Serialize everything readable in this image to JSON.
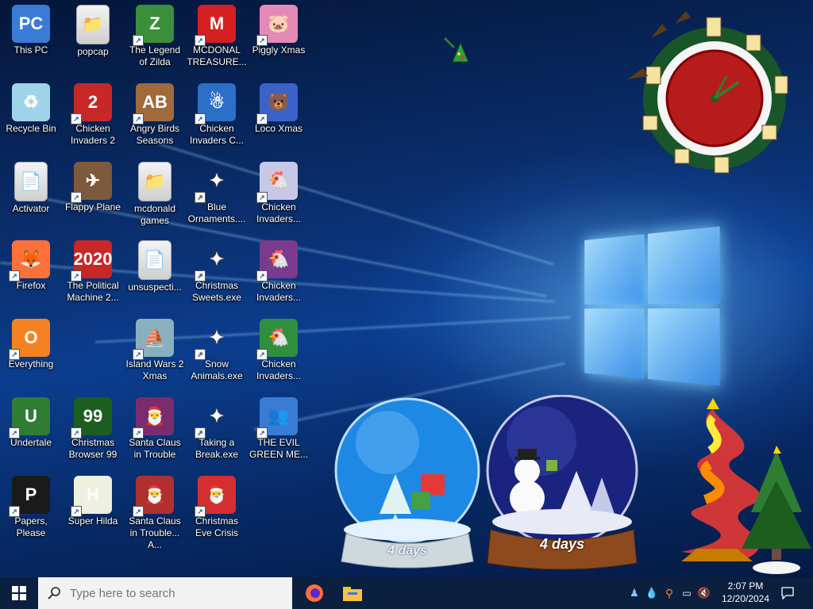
{
  "desktop": {
    "icons": [
      {
        "label": "This PC",
        "art": "PC",
        "color": "#3a7bd5"
      },
      {
        "label": "popcap",
        "art": "📁",
        "color": "#dddddd"
      },
      {
        "label": "The Legend of Zilda",
        "art": "Z",
        "color": "#3b8f3b"
      },
      {
        "label": "MCDONAL TREASURE...",
        "art": "M",
        "color": "#d42020"
      },
      {
        "label": "Piggly Xmas",
        "art": "🐷",
        "color": "#e58ab7"
      },
      {
        "label": "Recycle Bin",
        "art": "♻",
        "color": "#9fd4e8"
      },
      {
        "label": "Chicken Invaders 2",
        "art": "2",
        "color": "#c62828"
      },
      {
        "label": "Angry Birds Seasons",
        "art": "AB",
        "color": "#a06a3a"
      },
      {
        "label": "Chicken Invaders C...",
        "art": "☃",
        "color": "#2b6fc7"
      },
      {
        "label": "Loco Xmas",
        "art": "🐻",
        "color": "#3b62c8"
      },
      {
        "label": "Activator",
        "art": "📄",
        "color": "#dddddd"
      },
      {
        "label": "Flappy Plane",
        "art": "✈",
        "color": "#7d5a3c"
      },
      {
        "label": "mcdonald games",
        "art": "📁",
        "color": "#dddddd"
      },
      {
        "label": "Blue Ornaments....",
        "art": "✦",
        "color": "#f5a623"
      },
      {
        "label": "Chicken Invaders...",
        "art": "🐔",
        "color": "#c7c7e8"
      },
      {
        "label": "Firefox",
        "art": "🦊",
        "color": "#ff7139"
      },
      {
        "label": "The Political Machine 2...",
        "art": "2020",
        "color": "#c62828"
      },
      {
        "label": "unsuspecti...",
        "art": "📄",
        "color": "#dddddd"
      },
      {
        "label": "Christmas Sweets.exe",
        "art": "✦",
        "color": "#f5a623"
      },
      {
        "label": "Chicken Invaders...",
        "art": "🐔",
        "color": "#7a3b8f"
      },
      {
        "label": "Everything",
        "art": "O",
        "color": "#f58220"
      },
      {
        "label": "Island Wars 2 Xmas",
        "art": "⛵",
        "color": "#8ab0c0"
      },
      {
        "label": "Snow Animals.exe",
        "art": "✦",
        "color": "#f5a623"
      },
      {
        "label": "Chicken Invaders...",
        "art": "🐔",
        "color": "#2f8f3f"
      },
      {
        "label": "Undertale",
        "art": "U",
        "color": "#2e7d32"
      },
      {
        "label": "Christmas Browser 99",
        "art": "99",
        "color": "#1b5e20"
      },
      {
        "label": "Santa Claus in Trouble",
        "art": "🎅",
        "color": "#7b2c6f"
      },
      {
        "label": "Taking a Break.exe",
        "art": "✦",
        "color": "#f5a623"
      },
      {
        "label": "THE EVIL GREEN ME...",
        "art": "👥",
        "color": "#3a7bd5"
      },
      {
        "label": "Papers, Please",
        "art": "P",
        "color": "#1a1a1a"
      },
      {
        "label": "Super Hilda",
        "art": "H",
        "color": "#f0f0e0"
      },
      {
        "label": "Santa Claus in Trouble... A...",
        "art": "🎅",
        "color": "#b03030"
      },
      {
        "label": "Christmas Eve Crisis",
        "art": "🎅",
        "color": "#d32f2f"
      }
    ]
  },
  "widgets": {
    "globe_left": {
      "label": "4 days"
    },
    "globe_right": {
      "label": "4 days"
    }
  },
  "taskbar": {
    "search": {
      "placeholder": "Type here to search"
    },
    "clock": {
      "time": "2:07 PM",
      "date": "12/20/2024"
    }
  }
}
